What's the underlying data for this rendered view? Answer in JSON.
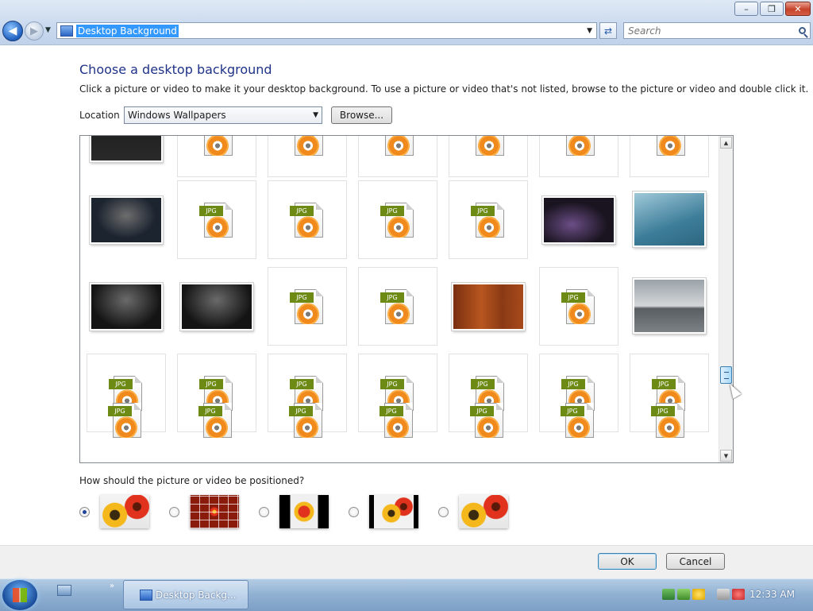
{
  "window": {
    "address": "Desktop Background",
    "search_placeholder": "Search",
    "minimize_glyph": "–",
    "maximize_glyph": "❐",
    "close_glyph": "✕"
  },
  "header": {
    "title": "Choose a desktop background",
    "description": "Click a picture or video to make it your desktop background. To use a picture or video that's not listed, browse to the picture or video and double click it."
  },
  "location": {
    "label": "Location",
    "selected": "Windows Wallpapers",
    "browse_label": "Browse..."
  },
  "gallery": {
    "file_badge": "JPG",
    "rows": [
      [
        "photo-dark",
        "jpg",
        "jpg",
        "jpg",
        "jpg",
        "jpg",
        "jpg"
      ],
      [
        "photo-dark-figure",
        "jpg",
        "jpg",
        "jpg",
        "jpg",
        "photo-purple",
        "photo-waterdrop"
      ],
      [
        "photo-gray",
        "photo-gray",
        "jpg",
        "jpg",
        "photo-wood",
        "jpg",
        "photo-city"
      ],
      [
        "jpg",
        "jpg",
        "jpg",
        "jpg",
        "jpg",
        "jpg",
        "jpg"
      ],
      [
        "jpg",
        "jpg",
        "jpg",
        "jpg",
        "jpg",
        "jpg",
        "jpg"
      ]
    ]
  },
  "positioning": {
    "question": "How should the picture or video be positioned?",
    "options": [
      "fill",
      "tile",
      "center",
      "fit",
      "stretch"
    ],
    "selected": "fill"
  },
  "buttons": {
    "ok": "OK",
    "cancel": "Cancel"
  },
  "taskbar": {
    "task_label": "Desktop Backg...",
    "quicklaunch_more": "»",
    "clock": "12:33 AM"
  },
  "colors": {
    "accent": "#1e3287",
    "selection": "#3399ff",
    "jpg_badge": "#6d8a14",
    "jpg_disc": "#f08a1d"
  }
}
